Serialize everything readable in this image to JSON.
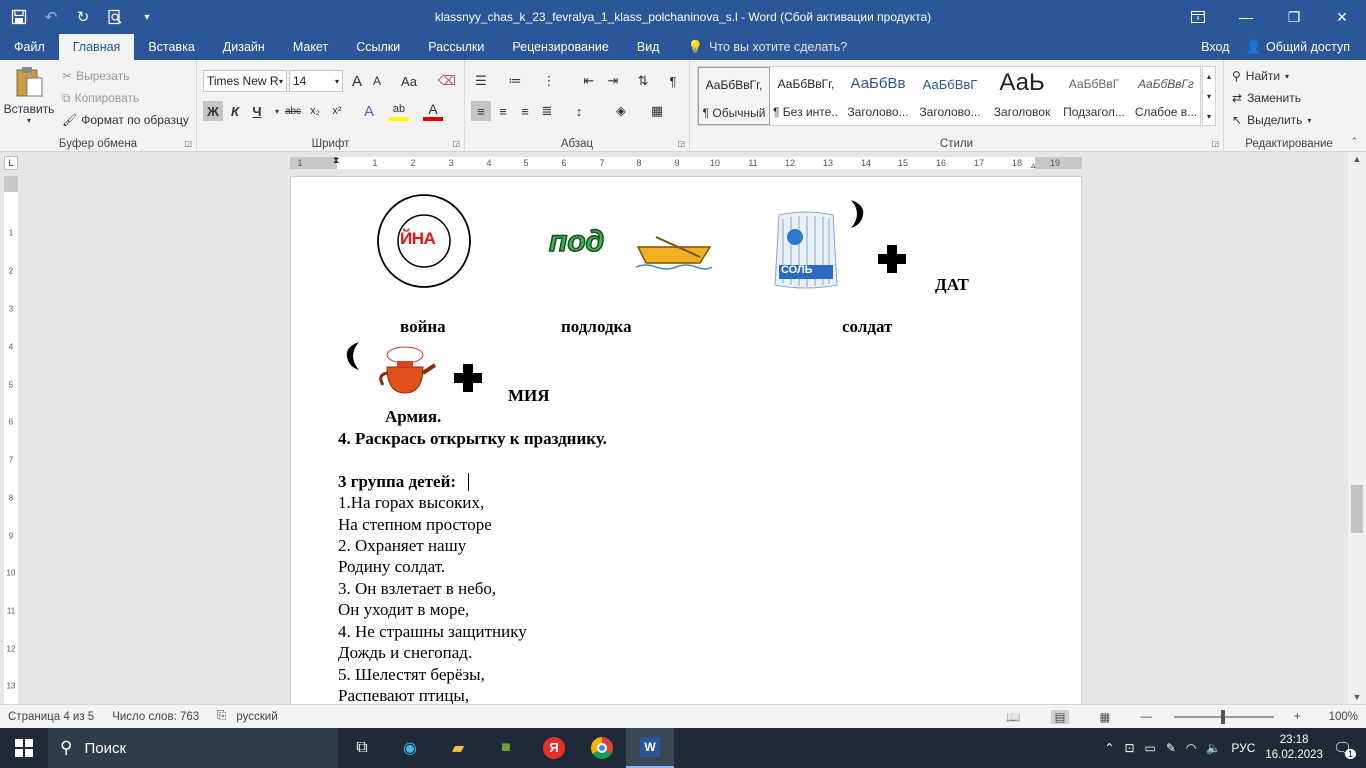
{
  "window": {
    "title": "klassnyy_chas_k_23_fevralya_1_klass_polchaninova_s.l - Word (Сбой активации продукта)"
  },
  "tabs": [
    "Файл",
    "Главная",
    "Вставка",
    "Дизайн",
    "Макет",
    "Ссылки",
    "Рассылки",
    "Рецензирование",
    "Вид"
  ],
  "tell_me": "Что вы хотите сделать?",
  "account": {
    "signin": "Вход",
    "share": "Общий доступ"
  },
  "clipboard": {
    "paste": "Вставить",
    "cut": "Вырезать",
    "copy": "Копировать",
    "format_painter": "Формат по образцу",
    "label": "Буфер обмена"
  },
  "font": {
    "name": "Times New R",
    "size": "14",
    "label": "Шрифт",
    "bold": "Ж",
    "italic": "К",
    "underline": "Ч",
    "strike": "abc",
    "subscript": "x₂",
    "superscript": "x²",
    "grow": "A",
    "shrink": "A",
    "case": "Аа",
    "effects": "A",
    "highlight": "ab",
    "color": "A"
  },
  "paragraph": {
    "label": "Абзац"
  },
  "styles": {
    "label": "Стили",
    "items": [
      {
        "preview": "АаБбВвГг,",
        "name": "¶ Обычный"
      },
      {
        "preview": "АаБбВвГг,",
        "name": "¶ Без инте..."
      },
      {
        "preview": "АаБбВв",
        "name": "Заголово..."
      },
      {
        "preview": "АаБбВвГ",
        "name": "Заголово..."
      },
      {
        "preview": "АаЬ",
        "name": "Заголовок"
      },
      {
        "preview": "АаБбВвГ",
        "name": "Подзагол..."
      },
      {
        "preview": "АаБбВвГг",
        "name": "Слабое в..."
      }
    ]
  },
  "editing": {
    "find": "Найти",
    "replace": "Заменить",
    "select": "Выделить",
    "label": "Редактирование"
  },
  "ruler": {
    "h_ticks": [
      "1",
      "1",
      "2",
      "3",
      "4",
      "5",
      "6",
      "7",
      "8",
      "9",
      "10",
      "11",
      "12",
      "13",
      "14",
      "15",
      "16",
      "17",
      "18",
      "19"
    ],
    "v_ticks": [
      "1",
      "2",
      "3",
      "4",
      "5",
      "6",
      "7",
      "8",
      "9",
      "10",
      "11",
      "12",
      "13"
    ]
  },
  "document": {
    "img_text_yna": "ЙНА",
    "img_text_pod": "под",
    "img_text_sol": "СОЛЬ",
    "dat": "ДАТ",
    "caption_voyna": "война",
    "caption_podlodka": "подлодка",
    "caption_soldat": "солдат",
    "miya": "МИЯ",
    "caption_armiya": "Армия.",
    "task4": "4. Раскрась открытку к празднику.",
    "group3": "3 группа детей:",
    "lines": [
      "1.На горах высоких,",
      "На степном просторе",
      "2. Охраняет нашу",
      "Родину солдат.",
      "3. Он взлетает в небо,",
      "Он уходит в море,",
      "4. Не страшны защитнику",
      "Дождь и снегопад.",
      "5. Шелестят берёзы,",
      "Распевают птицы,"
    ]
  },
  "status": {
    "page": "Страница 4 из 5",
    "words": "Число слов: 763",
    "language": "русский",
    "zoom": "100%"
  },
  "taskbar": {
    "search": "Поиск",
    "lang": "РУС",
    "time": "23:18",
    "date": "16.02.2023",
    "notifications": "1"
  }
}
